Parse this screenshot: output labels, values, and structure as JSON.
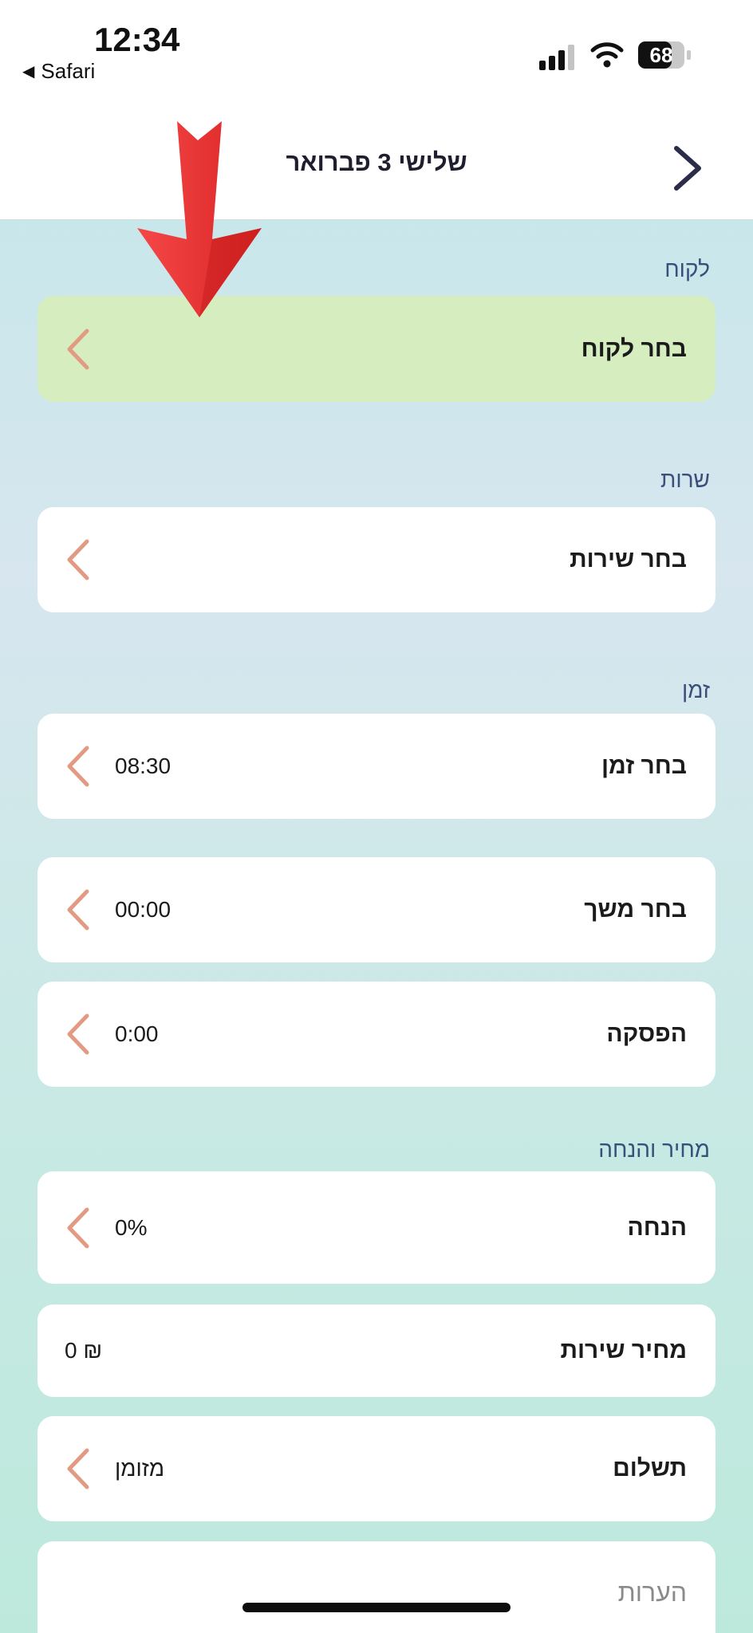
{
  "status_bar": {
    "time": "12:34",
    "back_app": "Safari",
    "battery": "68"
  },
  "nav": {
    "title": "שלישי 3 פברואר"
  },
  "sections": {
    "client": "לקוח",
    "service": "שרות",
    "time": "זמן",
    "price": "מחיר והנחה"
  },
  "rows": {
    "choose_client": {
      "label": "בחר לקוח"
    },
    "choose_service": {
      "label": "בחר שירות"
    },
    "choose_time": {
      "label": "בחר זמן",
      "value": "08:30"
    },
    "choose_duration": {
      "label": "בחר משך",
      "value": "00:00"
    },
    "break": {
      "label": "הפסקה",
      "value": "0:00"
    },
    "discount": {
      "label": "הנחה",
      "value": "0%"
    },
    "service_price": {
      "label": "מחיר שירות",
      "value": "0 ₪"
    },
    "payment": {
      "label": "תשלום",
      "value": "מזומן"
    },
    "notes": {
      "label": "הערות"
    }
  },
  "colors": {
    "accent_chevron": "#e39a82",
    "highlight_row": "#d5edbf",
    "arrow": "#f03a3a"
  },
  "icons": {
    "chevron": "chevron-left-icon",
    "nav_back": "chevron-right-icon",
    "annotation": "red-arrow-down-icon"
  }
}
